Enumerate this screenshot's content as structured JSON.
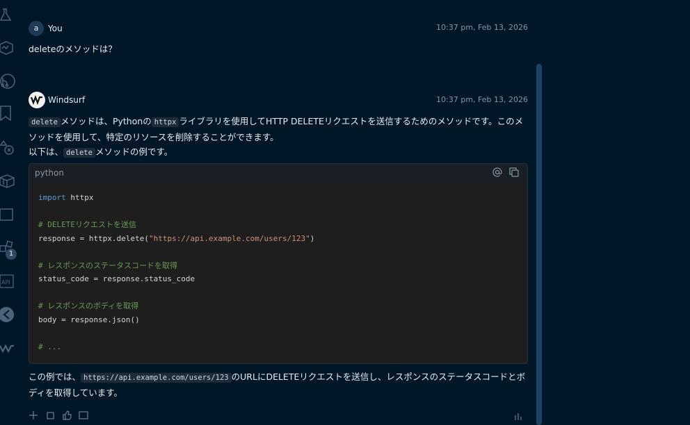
{
  "sidebar": {
    "icons": [
      "flask-icon",
      "activity-icon",
      "git-branch-icon",
      "bookmark-icon",
      "deploy-icon",
      "package-icon",
      "window-icon",
      "extensions-icon",
      "api-icon",
      "test-icon",
      "windsurf-icon"
    ],
    "extensions_badge": "1"
  },
  "user_message": {
    "avatar": "a",
    "author": "You",
    "timestamp": "10:37 pm, Feb 13, 2026",
    "text": "deleteのメソッドは？"
  },
  "assistant_message": {
    "author": "Windsurf",
    "timestamp": "10:37 pm, Feb 13, 2026",
    "para1": {
      "code1": "delete",
      "text1": "メソッドは、Pythonの",
      "code2": "httpx",
      "text2": "ライブラリを使用してHTTP DELETEリクエストを送信するためのメソッドです。このメソッドを使用して、特定のリソースを削除することができます。"
    },
    "para2": {
      "text1": "以下は、",
      "code1": "delete",
      "text2": "メソッドの例です。"
    },
    "code_block": {
      "language": "python",
      "line1_kw": "import",
      "line1_rest": " httpx",
      "line3": "# DELETEリクエストを送信",
      "line4_a": "response = httpx.delete(",
      "line4_str": "\"https://api.example.com/users/123\"",
      "line4_b": ")",
      "line6": "# レスポンスのステータスコードを取得",
      "line7": "status_code = response.status_code",
      "line9": "# レスポンスのボディを取得",
      "line10": "body = response.json()",
      "line12": "# ..."
    },
    "para3": {
      "text1": "この例では、",
      "code1": "https://api.example.com/users/123",
      "text2": "のURLにDELETEリクエストを送信し、レスポンスのステータスコードとボディを取得しています。"
    }
  }
}
